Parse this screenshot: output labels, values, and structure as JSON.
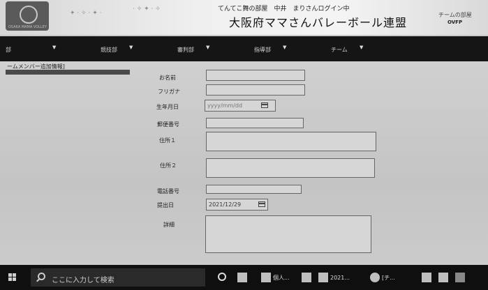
{
  "header": {
    "logo_caption": "OSAKA MAMA VOLLEY",
    "login_text": "てんてこ舞の部屋　中井　まりさんログイン中",
    "site_title": "大阪府ママさんバレーボール連盟",
    "team_page_link": "チームの部屋",
    "ovfp": "OVFP"
  },
  "nav": {
    "items": [
      {
        "label": "部"
      },
      {
        "label": "競技部"
      },
      {
        "label": "審判部"
      },
      {
        "label": "指導部"
      },
      {
        "label": "チーム"
      }
    ],
    "caret": "▼"
  },
  "panel": {
    "title": "ームメンバー追加情報]"
  },
  "form": {
    "name_label": "お名前",
    "furigana_label": "フリガナ",
    "birthdate_label": "生年月日",
    "birthdate_placeholder": "yyyy/mm/dd",
    "postal_label": "郵便番号",
    "address1_label": "住所１",
    "address2_label": "住所２",
    "phone_label": "電話番号",
    "submit_date_label": "提出日",
    "submit_date_value": "2021/12/29",
    "details_label": "詳細"
  },
  "taskbar": {
    "search_placeholder": "ここに入力して検索",
    "items": [
      {
        "label": "個人..."
      },
      {
        "label": "2021..."
      },
      {
        "label": "[チ..."
      }
    ]
  }
}
